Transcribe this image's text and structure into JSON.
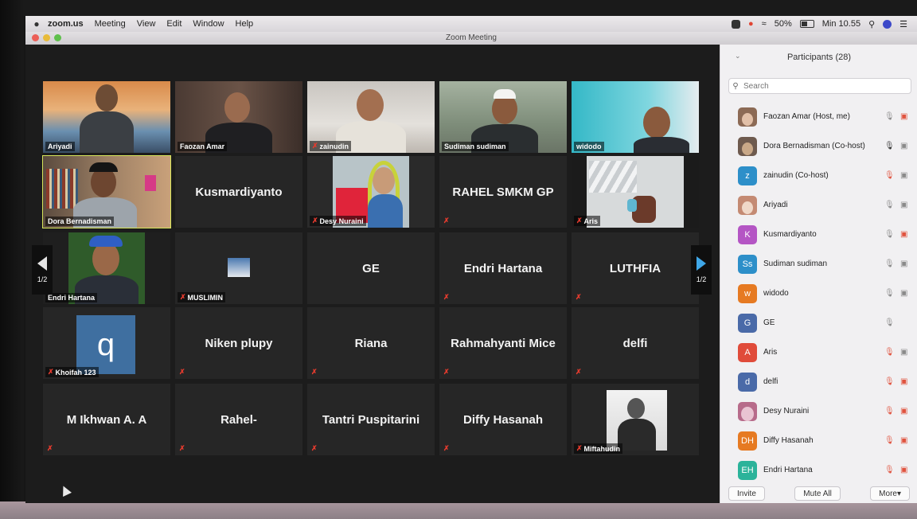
{
  "menubar": {
    "app_name": "zoom.us",
    "items": [
      "Meeting",
      "View",
      "Edit",
      "Window",
      "Help"
    ],
    "battery": "50%",
    "clock": "Min 10.55"
  },
  "window": {
    "title": "Zoom Meeting"
  },
  "gallery": {
    "page_indicator": "1/2",
    "tiles": [
      {
        "name": "Ariyadi"
      },
      {
        "name": "Faozan Amar"
      },
      {
        "name": "zainudin"
      },
      {
        "name": "Sudiman sudiman"
      },
      {
        "name": "widodo"
      },
      {
        "name": "Dora Bernadisman"
      },
      {
        "name": "Kusmardiyanto"
      },
      {
        "name": "Desy Nuraini"
      },
      {
        "name": "RAHEL SMKM GP"
      },
      {
        "name": "Aris"
      },
      {
        "name": "Endri Hartana"
      },
      {
        "name": "MUSLIMIN"
      },
      {
        "name": "GE"
      },
      {
        "name": "Endri Hartana"
      },
      {
        "name": "LUTHFIA"
      },
      {
        "name": "Khoifah 123",
        "avatar_letter": "q"
      },
      {
        "name": "Niken plupy"
      },
      {
        "name": "Riana"
      },
      {
        "name": "Rahmahyanti Mice"
      },
      {
        "name": "delfi"
      },
      {
        "name": "M Ikhwan A. A"
      },
      {
        "name": "Rahel-"
      },
      {
        "name": "Tantri Puspitarini"
      },
      {
        "name": "Diffy Hasanah"
      },
      {
        "name": "Miftahudin"
      }
    ]
  },
  "participants": {
    "title": "Participants (28)",
    "search_placeholder": "Search",
    "items": [
      {
        "name": "Faozan Amar (Host, me)",
        "initials": "",
        "color": "#8c6a55"
      },
      {
        "name": "Dora Bernadisman (Co-host)",
        "initials": "",
        "color": "#6e5a4e"
      },
      {
        "name": "zainudin (Co-host)",
        "initials": "z",
        "color": "#2d8fc9"
      },
      {
        "name": "Ariyadi",
        "initials": "",
        "color": "#c48a73"
      },
      {
        "name": "Kusmardiyanto",
        "initials": "K",
        "color": "#b455c4"
      },
      {
        "name": "Sudiman sudiman",
        "initials": "Ss",
        "color": "#2d8fc9"
      },
      {
        "name": "widodo",
        "initials": "w",
        "color": "#e67a22"
      },
      {
        "name": "GE",
        "initials": "G",
        "color": "#4a6aa8"
      },
      {
        "name": "Aris",
        "initials": "A",
        "color": "#e04b3a"
      },
      {
        "name": "delfi",
        "initials": "d",
        "color": "#4a6aa8"
      },
      {
        "name": "Desy Nuraini",
        "initials": "",
        "color": "#b76b8a"
      },
      {
        "name": "Diffy Hasanah",
        "initials": "DH",
        "color": "#e67a22"
      },
      {
        "name": "Endri Hartana",
        "initials": "EH",
        "color": "#2bb39a"
      }
    ],
    "buttons": {
      "invite": "Invite",
      "mute_all": "Mute All",
      "more": "More"
    }
  }
}
